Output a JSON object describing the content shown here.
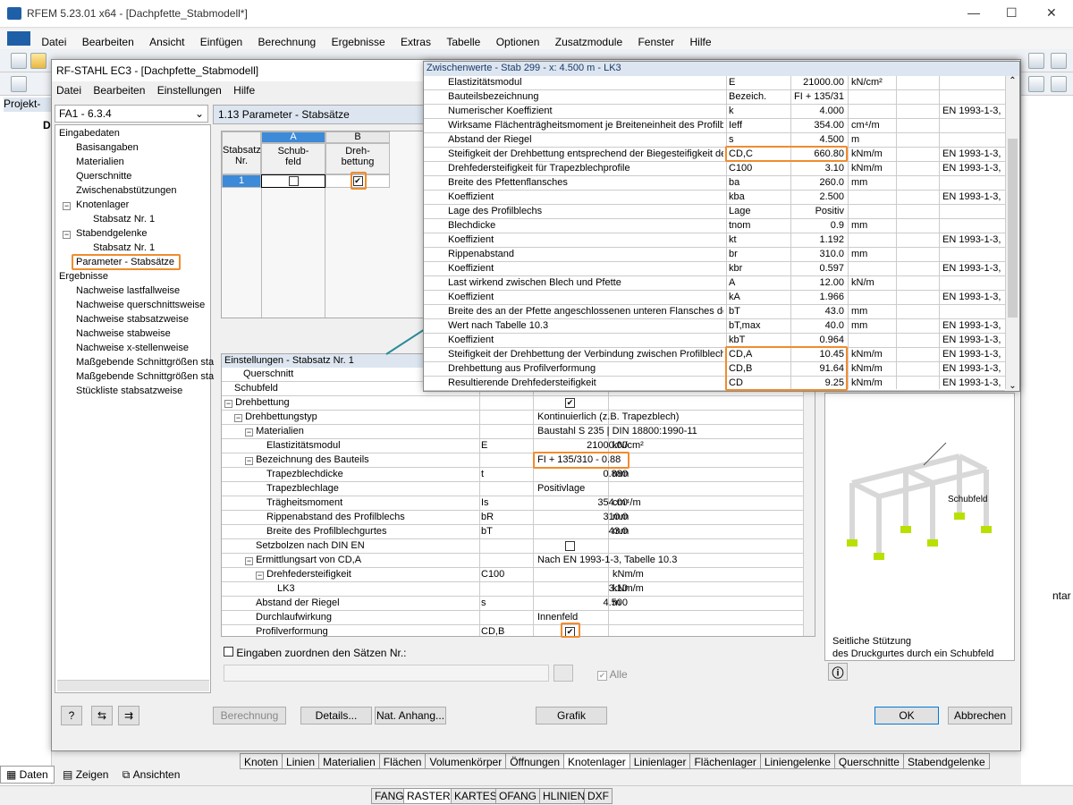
{
  "app": {
    "title": "RFEM 5.23.01 x64 - [Dachpfette_Stabmodell*]",
    "menu": [
      "Datei",
      "Bearbeiten",
      "Ansicht",
      "Einfügen",
      "Berechnung",
      "Ergebnisse",
      "Extras",
      "Tabelle",
      "Optionen",
      "Zusatzmodule",
      "Fenster",
      "Hilfe"
    ],
    "nav_panel_title": "Projekt-Na",
    "nav_root": "D"
  },
  "dialog": {
    "title": "RF-STAHL EC3 - [Dachpfette_Stabmodell]",
    "menu": [
      "Datei",
      "Bearbeiten",
      "Einstellungen",
      "Hilfe"
    ],
    "case_combo": "FA1 - 6.3.4",
    "page_title": "1.13 Parameter - Stabsätze",
    "tree": {
      "input_header": "Eingabedaten",
      "items": [
        "Basisangaben",
        "Materialien",
        "Querschnitte",
        "Zwischenabstützungen",
        "Knotenlager",
        "Stabsatz Nr. 1",
        "Stabendgelenke",
        "Stabsatz Nr. 1",
        "Parameter - Stabsätze"
      ],
      "results_header": "Ergebnisse",
      "results": [
        "Nachweise lastfallweise",
        "Nachweise querschnittsweise",
        "Nachweise stabsatzweise",
        "Nachweise stabweise",
        "Nachweise x-stellenweise",
        "Maßgebende Schnittgrößen sta",
        "Maßgebende Schnittgrößen sta",
        "Stückliste stabsatzweise"
      ]
    },
    "grid": {
      "col_a": "A",
      "col_b": "B",
      "rowhead_1": "Stabsatz",
      "rowhead_2": "Nr.",
      "a_head_1": "Schub-",
      "a_head_2": "feld",
      "b_head_1": "Dreh-",
      "b_head_2": "bettung",
      "row_no": "1"
    },
    "settings": {
      "header": "Einstellungen - Stabsatz Nr. 1",
      "rows": [
        {
          "label": "Querschnitt",
          "sym": "",
          "value": "",
          "unit": ""
        },
        {
          "label": "Schubfeld",
          "sym": "",
          "value": "",
          "unit": ""
        },
        {
          "label": "Drehbettung",
          "sym": "",
          "value": "",
          "unit": ""
        },
        {
          "label": "Drehbettungstyp",
          "sym": "",
          "value": "Kontinuierlich (z.B. Trapezblech)",
          "unit": ""
        },
        {
          "label": "Materialien",
          "sym": "",
          "value": "Baustahl S 235 | DIN 18800:1990-11",
          "unit": ""
        },
        {
          "label": "Elastizitätsmodul",
          "sym": "E",
          "value": "21000.00",
          "unit": "kN/cm²"
        },
        {
          "label": "Bezeichnung des Bauteils",
          "sym": "",
          "value": "FI + 135/310 - 0.88",
          "unit": ""
        },
        {
          "label": "Trapezblechdicke",
          "sym": "t",
          "value": "0.880",
          "unit": "mm"
        },
        {
          "label": "Trapezblechlage",
          "sym": "",
          "value": "Positivlage",
          "unit": ""
        },
        {
          "label": "Trägheitsmoment",
          "sym": "Is",
          "value": "354.00",
          "unit": "cm⁴/m"
        },
        {
          "label": "Rippenabstand des Profilblechs",
          "sym": "bR",
          "value": "310.0",
          "unit": "mm"
        },
        {
          "label": "Breite des Profilblechgurtes",
          "sym": "bT",
          "value": "43.0",
          "unit": "mm"
        },
        {
          "label": "Setzbolzen nach DIN EN",
          "sym": "",
          "value": "",
          "unit": ""
        },
        {
          "label": "Ermittlungsart von CD,A",
          "sym": "",
          "value": "Nach EN 1993-1-3, Tabelle 10.3",
          "unit": ""
        },
        {
          "label": "Drehfedersteifigkeit",
          "sym": "C100",
          "value": "",
          "unit": "kNm/m"
        },
        {
          "label": "LK3",
          "sym": "",
          "value": "3.10",
          "unit": "kNm/m"
        },
        {
          "label": "Abstand der Riegel",
          "sym": "s",
          "value": "4.500",
          "unit": "m"
        },
        {
          "label": "Durchlaufwirkung",
          "sym": "",
          "value": "Innenfeld",
          "unit": ""
        },
        {
          "label": "Profilverformung",
          "sym": "CD,B",
          "value": "",
          "unit": ""
        }
      ],
      "assign_label": "Eingaben zuordnen den Sätzen Nr.:",
      "all_label": "Alle"
    },
    "preview": {
      "callout": "Schubfeld",
      "caption_1": "Seitliche Stützung",
      "caption_2": "des Druckgurtes durch ein Schubfeld"
    },
    "buttons": {
      "calc": "Berechnung",
      "details": "Details...",
      "annex": "Nat. Anhang...",
      "graphic": "Grafik",
      "ok": "OK",
      "cancel": "Abbrechen"
    }
  },
  "popup": {
    "title": "Zwischenwerte - Stab 299 - x: 4.500 m - LK3",
    "rows": [
      {
        "label": "Elastizitätsmodul",
        "sym": "E",
        "value": "21000.00",
        "unit": "kN/cm²",
        "ref": ""
      },
      {
        "label": "Bauteilsbezeichnung",
        "sym": "Bezeich.",
        "value": "FI + 135/31",
        "unit": "",
        "ref": ""
      },
      {
        "label": "Numerischer Koeffizient",
        "sym": "k",
        "value": "4.000",
        "unit": "",
        "ref": "EN 1993-1-3,"
      },
      {
        "label": "Wirksame Flächenträgheitsmoment je Breiteneinheit des Profilblec",
        "sym": "Ieff",
        "value": "354.00",
        "unit": "cm⁴/m",
        "ref": ""
      },
      {
        "label": "Abstand der Riegel",
        "sym": "s",
        "value": "4.500",
        "unit": "m",
        "ref": ""
      },
      {
        "label": "Steifigkeit der Drehbettung entsprechend der Biegesteifigkeit des",
        "sym": "CD,C",
        "value": "660.80",
        "unit": "kNm/m",
        "ref": "EN 1993-1-3,"
      },
      {
        "label": "Drehfedersteifigkeit für Trapezblechprofile",
        "sym": "C100",
        "value": "3.10",
        "unit": "kNm/m",
        "ref": "EN 1993-1-3,"
      },
      {
        "label": "Breite des Pfettenflansches",
        "sym": "ba",
        "value": "260.0",
        "unit": "mm",
        "ref": ""
      },
      {
        "label": "Koeffizient",
        "sym": "kba",
        "value": "2.500",
        "unit": "",
        "ref": "EN 1993-1-3,"
      },
      {
        "label": "Lage des Profilblechs",
        "sym": "Lage",
        "value": "Positiv",
        "unit": "",
        "ref": ""
      },
      {
        "label": "Blechdicke",
        "sym": "tnom",
        "value": "0.9",
        "unit": "mm",
        "ref": ""
      },
      {
        "label": "Koeffizient",
        "sym": "kt",
        "value": "1.192",
        "unit": "",
        "ref": "EN 1993-1-3,"
      },
      {
        "label": "Rippenabstand",
        "sym": "br",
        "value": "310.0",
        "unit": "mm",
        "ref": ""
      },
      {
        "label": "Koeffizient",
        "sym": "kbr",
        "value": "0.597",
        "unit": "",
        "ref": "EN 1993-1-3,"
      },
      {
        "label": "Last wirkend zwischen Blech und Pfette",
        "sym": "A",
        "value": "12.00",
        "unit": "kN/m",
        "ref": ""
      },
      {
        "label": "Koeffizient",
        "sym": "kA",
        "value": "1.966",
        "unit": "",
        "ref": "EN 1993-1-3,"
      },
      {
        "label": "Breite des an der Pfette angeschlossenen unteren Flansches des",
        "sym": "bT",
        "value": "43.0",
        "unit": "mm",
        "ref": ""
      },
      {
        "label": "Wert nach Tabelle 10.3",
        "sym": "bT,max",
        "value": "40.0",
        "unit": "mm",
        "ref": "EN 1993-1-3,"
      },
      {
        "label": "Koeffizient",
        "sym": "kbT",
        "value": "0.964",
        "unit": "",
        "ref": "EN 1993-1-3,"
      },
      {
        "label": "Steifigkeit der Drehbettung der Verbindung zwischen Profilblech u",
        "sym": "CD,A",
        "value": "10.45",
        "unit": "kNm/m",
        "ref": "EN 1993-1-3,"
      },
      {
        "label": "Drehbettung aus Profilverformung",
        "sym": "CD,B",
        "value": "91.64",
        "unit": "kNm/m",
        "ref": "EN 1993-1-3,"
      },
      {
        "label": "Resultierende Drehfedersteifigkeit",
        "sym": "CD",
        "value": "9.25",
        "unit": "kNm/m",
        "ref": "EN 1993-1-3,"
      }
    ]
  },
  "bottom_tabs": [
    "Knoten",
    "Linien",
    "Materialien",
    "Flächen",
    "Volumenkörper",
    "Öffnungen",
    "Knotenlager",
    "Linienlager",
    "Flächenlager",
    "Liniengelenke",
    "Querschnitte",
    "Stabendgelenke"
  ],
  "nav_tabs": [
    "Daten",
    "Zeigen",
    "Ansichten"
  ],
  "status": [
    "FANG",
    "RASTER",
    "KARTES",
    "OFANG",
    "HLINIEN",
    "DXF"
  ],
  "right_panel_text": "ntar",
  "colors": {
    "highlight": "#f08c2e",
    "arrow": "#2a8a9a",
    "accent": "#1a3a6a"
  }
}
